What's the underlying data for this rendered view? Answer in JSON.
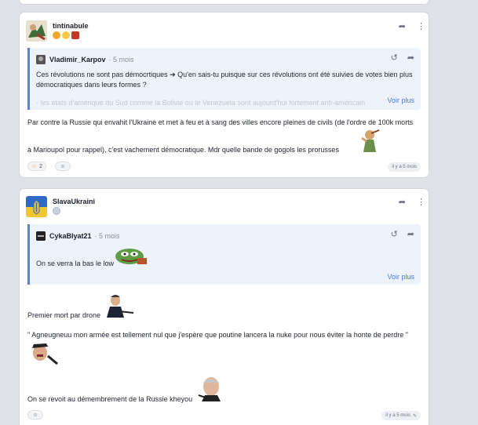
{
  "posts": [
    {
      "username": "tintinabule",
      "header_icons": [
        "share-icon",
        "more-icon"
      ],
      "quote": {
        "user": "Vladimir_Karpov",
        "time": "· 5 mois",
        "text": "Ces révolutions ne sont pas démocrtiques ➔ Qu'en sais-tu puisque sur ces révolutions ont été suivies de votes bien plus démocratiques dans leurs formes ?",
        "faded_text": "- les états d'amérique du Sud comme la Bolivie ou le Venezuela sont aujourd'hui fortement anti-américain",
        "more_link": "Voir plus"
      },
      "body_line1": "Par contre la Russie qui envahit l'Ukraine et met à feu et à sang des villes encore pleines de civils (de l'ordre de 100k morts",
      "body_line2": "à Marioupol pour rappel), c'est vachement démocratique. Mdr quelle bande de gogols les prorusses",
      "reaction_count": "2",
      "timestamp": "il y a 5 mois"
    },
    {
      "username": "SlavaUkraini",
      "header_icons": [
        "share-icon",
        "more-icon"
      ],
      "quote": {
        "user": "CykaBlyat21",
        "time": "· 5 mois",
        "text": "On se verra la bas le low",
        "more_link": "Voir plus"
      },
      "line1": "Premier mort par drone",
      "line2": "\" Agneugneuu mon armée est tellement nul que j'espère que poutine lancera la nuke pour nous éviter la honte de perdre \"",
      "line3": "On se revoit au démembrement de la Russie kheyou",
      "timestamp": "il y a 5 mois"
    }
  ],
  "colors": {
    "accent": "#4a79e0",
    "quote_bg": "#eef3fb",
    "quote_border": "#5b7ee8",
    "page_bg": "#dfe1e6"
  }
}
